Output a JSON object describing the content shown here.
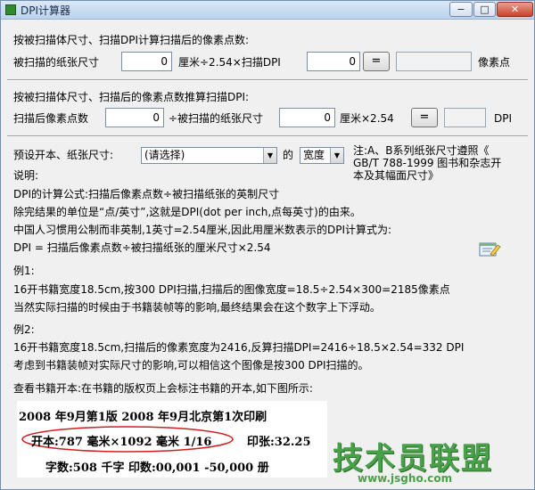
{
  "window": {
    "title": "DPI计算器",
    "min": "−",
    "max": "□",
    "close": "✕"
  },
  "section1": {
    "heading": "按被扫描体尺寸、扫描DPI计算扫描后的像素点数:",
    "size_label": "被扫描的纸张尺寸",
    "size_value": "0",
    "mid_label": "厘米÷2.54×扫描DPI",
    "dpi_value": "0",
    "button": "=",
    "result_label": "像素点"
  },
  "section2": {
    "heading": "按被扫描体尺寸、扫描后的像素点数推算扫描DPI:",
    "pixels_label": "扫描后像素点数",
    "pixels_value": "0",
    "mid_label": "÷被扫描的纸张尺寸",
    "size_value": "0",
    "unit_label": "厘米×2.54",
    "button": "=",
    "result_label": "DPI"
  },
  "preset": {
    "label": "预设开本、纸张尺寸:",
    "select_value": "(请选择)",
    "of_label": "的",
    "dim_value": "宽度",
    "note": [
      "注:A、B系列纸张尺寸遵照《",
      "GB/T 788-1999 图书和杂志开",
      "本及其幅面尺寸》"
    ]
  },
  "explanation": {
    "title": "说明:",
    "lines": [
      "DPI的计算公式:扫描后像素点数÷被扫描纸张的英制尺寸",
      "除完结果的单位是“点/英寸”,这就是DPI(dot per inch,点每英寸)的由来。",
      "中国人习惯用公制而非英制,1英寸=2.54厘米,因此用厘米数表示的DPI计算式为:",
      "DPI = 扫描后像素点数÷被扫描纸张的厘米尺寸×2.54"
    ],
    "example1_title": "例1:",
    "example1_lines": [
      "16开书籍宽度18.5cm,按300 DPI扫描,扫描后的图像宽度=18.5÷2.54×300=2185像素点",
      "当然实际扫描的时候由于书籍装帧等的影响,最终结果会在这个数字上下浮动。"
    ],
    "example2_title": "例2:",
    "example2_lines": [
      "16开书籍宽度18.5cm,扫描后的像素宽度为2416,反算扫描DPI=2416÷18.5×2.54=332 DPI",
      "考虑到书籍装帧对实际尺寸的影响,可以相信这个图像是按300 DPI扫描的。"
    ],
    "lookup": "查看书籍开本:在书籍的版权页上会标注书籍的开本,如下图所示:"
  },
  "book_image": {
    "line1": "2008 年9月第1版   2008 年9月北京第1次印刷",
    "format": "开本:787 毫米×1092 毫米  1/16",
    "sheets": "印张:32.25",
    "line3": "字数:508 千字   印数:00,001 -50,000 册"
  },
  "watermark": {
    "main": "技术员联盟",
    "url": "www.jsgho.com"
  },
  "colors": {
    "watermark": "#48a048",
    "title_bar": "#bcd3ee",
    "ellipse": "#d22020"
  }
}
